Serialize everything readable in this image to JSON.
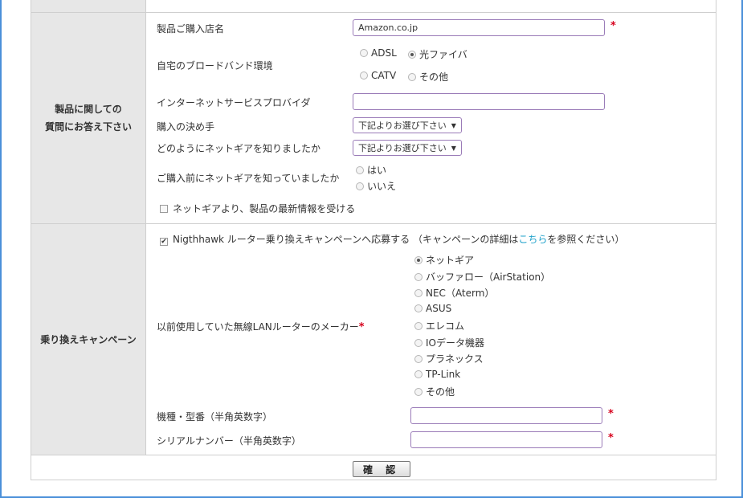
{
  "product_section": {
    "heading_line1": "製品に関しての",
    "heading_line2": "質問にお答え下さい",
    "store": {
      "label": "製品ご購入店名",
      "value": "Amazon.co.jp",
      "required_mark": "*"
    },
    "broadband": {
      "label": "自宅のブロードバンド環境",
      "options": [
        "ADSL",
        "光ファイバ",
        "CATV",
        "その他"
      ],
      "selected": "光ファイバ"
    },
    "isp": {
      "label": "インターネットサービスプロバイダ",
      "value": ""
    },
    "decision": {
      "label": "購入の決め手",
      "selected_value": "下記よりお選び下さい",
      "arrow": "▼"
    },
    "how_known": {
      "label": "どのようにネットギアを知りましたか",
      "selected_value": "下記よりお選び下さい",
      "arrow": "▼"
    },
    "known_before": {
      "label": "ご購入前にネットギアを知っていましたか",
      "options": [
        "はい",
        "いいえ"
      ]
    },
    "newsletter": {
      "label": "ネットギアより、製品の最新情報を受ける",
      "checked": false
    }
  },
  "campaign_section": {
    "heading": "乗り換えキャンペーン",
    "apply": {
      "checked": true,
      "check_mark": "✔",
      "label": "Nigthhawk ルーター乗り換えキャンペーンへ応募する （キャンペーンの詳細は",
      "link": "こちら",
      "suffix": "を参照ください）"
    },
    "maker": {
      "label": "以前使用していた無線LANルーターのメーカー",
      "required_mark": "*",
      "options": [
        "ネットギア",
        "バッファロー（AirStation）",
        "NEC（Aterm）",
        "ASUS",
        "エレコム",
        "IOデータ機器",
        "プラネックス",
        "TP-Link",
        "その他"
      ],
      "selected": "ネットギア"
    },
    "model": {
      "label": "機種・型番（半角英数字）",
      "value": "",
      "required_mark": "*"
    },
    "serial": {
      "label": "シリアルナンバー（半角英数字）",
      "value": "",
      "required_mark": "*"
    }
  },
  "footer": {
    "confirm_label": "確 認"
  },
  "colors": {
    "accent_border": "#4a90d9",
    "input_border": "#9a7bb8",
    "required": "#d6001c",
    "link": "#1a9fc9",
    "header_bg": "#e7e7e7"
  }
}
